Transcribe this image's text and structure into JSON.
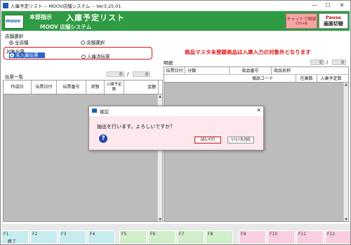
{
  "window": {
    "title": "入庫予定リスト -- MOOV店舗システム -- Ver3.25.01",
    "min": "—",
    "max": "☐",
    "close": "✕"
  },
  "header": {
    "logo": "moov",
    "dept": "本部指示",
    "title": "入庫予定リスト",
    "system": "MOOV 店舗システム",
    "chat_label": "チャットで相談",
    "chat_key": "Ctrl+B",
    "pause_label": "Pause",
    "pause_sub": "画面切替"
  },
  "store_select": {
    "label": "店舗選択",
    "options": [
      {
        "label": "全店舗",
        "selected": true
      },
      {
        "label": "店舗選択",
        "selected": false
      }
    ]
  },
  "target_slip": {
    "label": "対象伝票",
    "options": [
      {
        "label": "未入庫伝票",
        "selected": true
      },
      {
        "label": "入庫済伝票",
        "selected": false
      }
    ]
  },
  "warning": "商品マスタ未登録商品は入庫入力の対象外となります",
  "detail": {
    "label": "明細",
    "count": "0",
    "total": "0"
  },
  "slip_list": {
    "label": "伝票一覧",
    "count": "0",
    "total": "0",
    "columns": [
      "作成日",
      "伝票日付",
      "伝票番号",
      "状態",
      "入庫予定数",
      "金額"
    ]
  },
  "detail_grid": {
    "columns_row1": [
      "伝票日付",
      "分類",
      "商品番号",
      "商品名称"
    ],
    "columns_row2": [
      "個品コード",
      "在庫数",
      "入庫予定数"
    ]
  },
  "dialog": {
    "title": "確認",
    "close": "✕",
    "message": "抽出を行います。よろしいですか？",
    "icon": "?",
    "yes_label": "はい(Y)",
    "no_label": "いいえ(N)"
  },
  "fkeys": [
    {
      "key": "F1",
      "caption": "終了",
      "color": "#c7ecef"
    },
    {
      "key": "F2",
      "caption": "",
      "color": "#c7ecef"
    },
    {
      "key": "F3",
      "caption": "",
      "color": "#c7ecef"
    },
    {
      "key": "F4",
      "caption": "",
      "color": "#c7ecef"
    },
    {
      "key": "F5",
      "caption": "",
      "color": "#cfeec9"
    },
    {
      "key": "F6",
      "caption": "",
      "color": "#cfeec9"
    },
    {
      "key": "F7",
      "caption": "",
      "color": "#cfeec9"
    },
    {
      "key": "F8",
      "caption": "",
      "color": "#cfeec9"
    },
    {
      "key": "F9",
      "caption": "",
      "color": "#f8cfe0"
    },
    {
      "key": "F10",
      "caption": "",
      "color": "#f8cfe0"
    },
    {
      "key": "F11",
      "caption": "",
      "color": "#f8cfe0"
    },
    {
      "key": "F12",
      "caption": "",
      "color": "#f8cfe0"
    }
  ]
}
